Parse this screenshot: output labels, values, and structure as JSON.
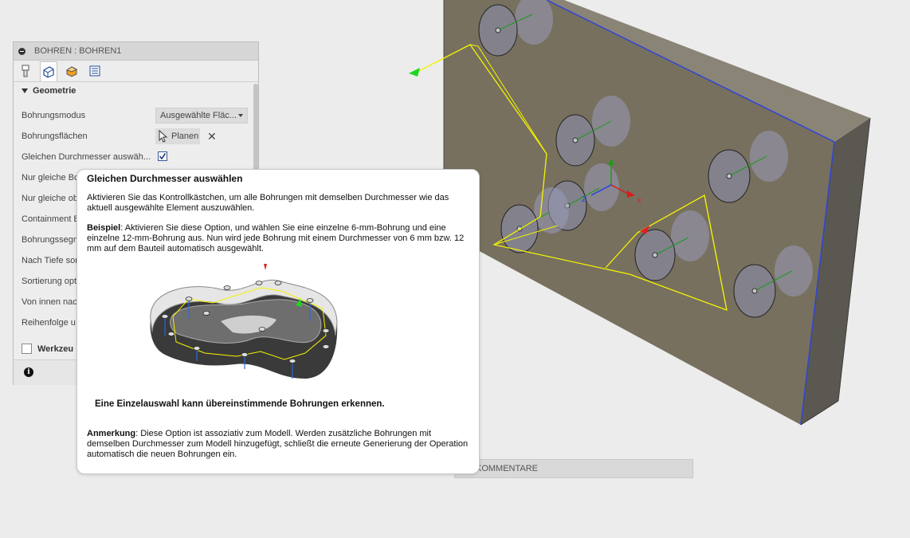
{
  "panel": {
    "title": "BOHREN : BOHREN1",
    "tabs": [
      "tool-tab",
      "geometry-tab",
      "heights-tab",
      "cycle-tab"
    ],
    "group_geometry": "Geometrie",
    "rows": [
      {
        "label": "Bohrungsmodus"
      },
      {
        "label": "Bohrungsflächen"
      },
      {
        "label": "Gleichen Durchmesser auswäh..."
      },
      {
        "label": "Nur gleiche Bo"
      },
      {
        "label": "Nur gleiche ob"
      },
      {
        "label": "Containment B"
      },
      {
        "label": "Bohrungssegm"
      },
      {
        "label": "Nach Tiefe sor"
      },
      {
        "label": "Sortierung opt"
      },
      {
        "label": "Von innen nac"
      },
      {
        "label": "Reihenfolge u"
      }
    ],
    "mode_value": "Ausgewählte Fläc...",
    "faces_value": "Planen",
    "same_diameter_checked": true,
    "group_tool": "Werkzeu"
  },
  "comments_bar": "KOMMENTARE",
  "tooltip": {
    "title": "Gleichen Durchmesser auswählen",
    "p1": "Aktivieren Sie das Kontrollkästchen, um alle Bohrungen mit demselben Durchmesser wie das aktuell ausgewählte Element auszuwählen.",
    "example_label": "Beispiel",
    "example_text": ": Aktivieren Sie diese Option, und wählen Sie eine einzelne 6-mm-Bohrung und eine einzelne 12-mm-Bohrung aus. Nun wird jede Bohrung mit einem Durchmesser von 6 mm bzw. 12 mm auf dem Bauteil automatisch ausgewählt.",
    "caption": "Eine Einzelauswahl kann übereinstimmende Bohrungen erkennen.",
    "note_label": "Anmerkung",
    "note_text": ": Diese Option ist assoziativ zum Modell. Werden zusätzliche Bohrungen mit demselben Durchmesser zum Modell hinzugefügt, schließt die erneute Generierung der Operation automatisch die neuen Bohrungen ein."
  },
  "colors": {
    "plate": "#77705f",
    "toolpath": "#f4f400",
    "edge_blue": "#2d44d8",
    "axis_green": "#1c9c1c",
    "axis_red": "#d81c1c"
  }
}
